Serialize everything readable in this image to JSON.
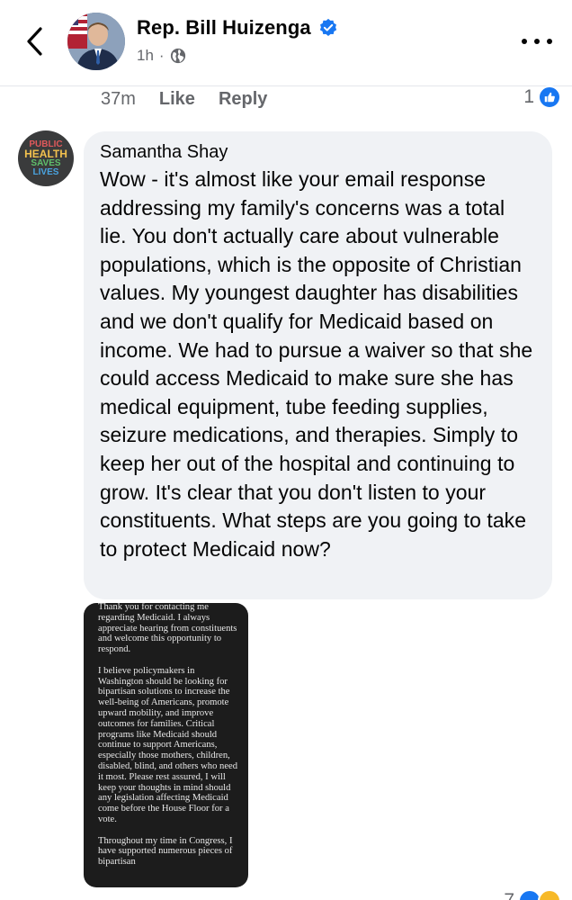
{
  "header": {
    "author_name": "Rep. Bill Huizenga",
    "timestamp": "1h",
    "separator": "·",
    "back_icon": "chevron-left-icon",
    "more_icon": "more-horizontal-icon",
    "verified_icon": "verified-badge-icon",
    "privacy_icon": "globe-icon"
  },
  "previous_comment": {
    "time": "37m",
    "like_label": "Like",
    "reply_label": "Reply",
    "reaction_count": "1"
  },
  "comment": {
    "author": "Samantha Shay",
    "avatar_lines": [
      "PUBLIC",
      "HEALTH",
      "SAVES",
      "LIVES"
    ],
    "avatar_colors": [
      "#e0595b",
      "#f2c14e",
      "#5fbf6b",
      "#4aa3df"
    ],
    "text": "Wow - it's almost like your email response addressing my family's concerns was a total lie. You don't actually care about vulnerable populations, which is the opposite of Christian values. My youngest daughter has disabilities and we don't qualify for Medicaid based on income. We had to pursue a waiver so that she could access Medicaid to make sure she has medical equipment, tube feeding supplies, seizure medications, and therapies. Simply to keep her out of the hospital and continuing to grow. It's clear that you don't listen to your constituents. What steps are you going to take to protect Medicaid now?"
  },
  "attachment": {
    "paragraphs": [
      "Thank you for contacting me regarding Medicaid. I always appreciate hearing from constituents and welcome this opportunity to respond.",
      "I believe policymakers in Washington should be looking for bipartisan solutions to increase the well-being of Americans, promote upward mobility, and improve outcomes for families. Critical programs like Medicaid should continue to support Americans, especially those mothers, children, disabled, blind, and others who need it most. Please rest assured, I will keep your thoughts in mind should any legislation affecting Medicaid come before the House Floor for a vote.",
      "Throughout my time in Congress, I have supported numerous pieces of bipartisan"
    ]
  },
  "next_comment": {
    "reaction_count": "7"
  },
  "colors": {
    "accent": "#1877f2",
    "bubble": "#f0f2f5",
    "secondary_text": "#65676b"
  }
}
